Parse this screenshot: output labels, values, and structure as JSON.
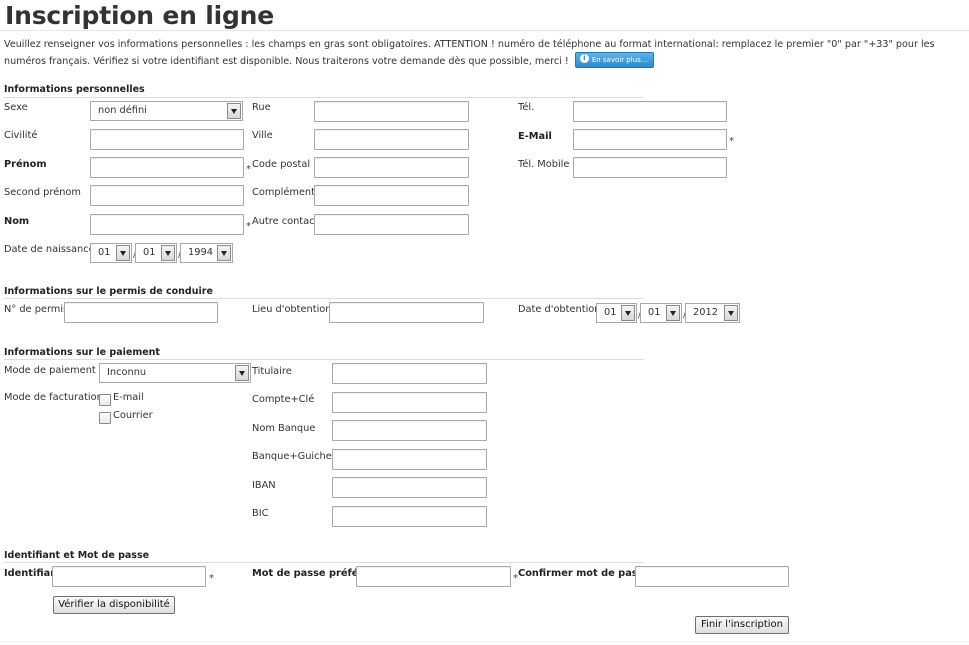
{
  "title": "Inscription en ligne",
  "intro": {
    "text": "Veuillez renseigner vos informations personnelles : les champs en gras sont obligatoires. ATTENTION ! numéro de téléphone au format international: remplacez le premier \"0\" par \"+33\" pour les numéros français. Vérifiez si votre identifiant est disponible. Nous traiterons votre demande dès que possible, merci !",
    "info_button": "En savoir plus..."
  },
  "personal": {
    "heading": "Informations personnelles",
    "sexe_label": "Sexe",
    "sexe_value": "non défini",
    "civilite_label": "Civilité",
    "prenom_label": "Prénom",
    "second_prenom_label": "Second prénom",
    "nom_label": "Nom",
    "naissance_label": "Date de naissance",
    "naissance_day": "01",
    "naissance_month": "01",
    "naissance_year": "1994",
    "rue_label": "Rue",
    "ville_label": "Ville",
    "code_postal_label": "Code postal",
    "complement_label": "Complément",
    "autre_contact_label": "Autre contact",
    "tel_label": "Tél.",
    "email_label": "E-Mail",
    "tel_mobile_label": "Tél. Mobile",
    "required_mark": "*",
    "date_sep": "/"
  },
  "permis": {
    "heading": "Informations sur le permis de conduire",
    "numero_label": "N° de permis",
    "lieu_label": "Lieu d'obtention",
    "date_label": "Date d'obtention",
    "date_day": "01",
    "date_month": "01",
    "date_year": "2012"
  },
  "paiement": {
    "heading": "Informations sur le paiement",
    "mode_paiement_label": "Mode de paiement",
    "mode_paiement_value": "Inconnu",
    "mode_facturation_label": "Mode de facturation",
    "option_email": "E-mail",
    "option_courrier": "Courrier",
    "titulaire_label": "Titulaire",
    "compte_label": "Compte+Clé",
    "banque_label": "Nom Banque",
    "guichet_label": "Banque+Guichet",
    "iban_label": "IBAN",
    "bic_label": "BIC"
  },
  "account": {
    "heading": "Identifiant et Mot de passe",
    "identifiant_label": "Identifiant",
    "password_label": "Mot de passe préféré",
    "confirm_label": "Confirmer mot de passe",
    "verify_button": "Vérifier la disponibilité",
    "finish_button": "Finir l'inscription"
  }
}
